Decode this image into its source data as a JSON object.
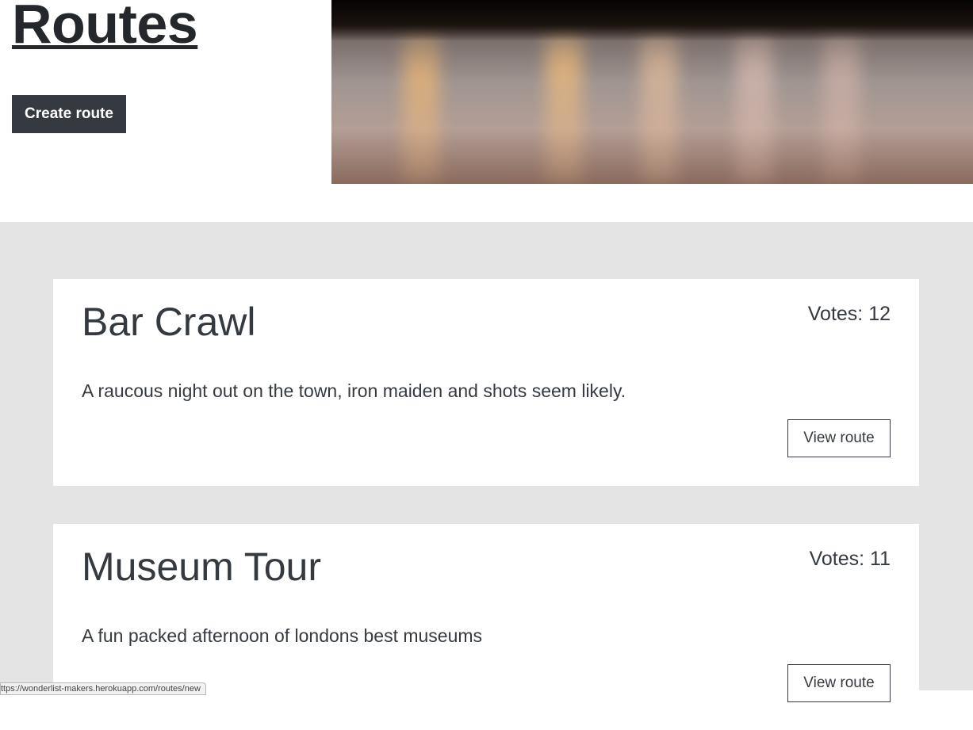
{
  "header": {
    "title": "Routes",
    "create_button_label": "Create route"
  },
  "routes": [
    {
      "name": "Bar Crawl",
      "votes": "Votes: 12",
      "description": "A raucous night out on the town, iron maiden and shots seem likely.",
      "view_button_label": "View route"
    },
    {
      "name": "Museum Tour",
      "votes": "Votes: 11",
      "description": "A fun packed afternoon of londons best museums",
      "view_button_label": "View route"
    }
  ],
  "status_bar": {
    "url": "ttps://wonderlist-makers.herokuapp.com/routes/new"
  },
  "colors": {
    "primary_dark": "#343a40",
    "section_gray": "#e4e4e4"
  }
}
